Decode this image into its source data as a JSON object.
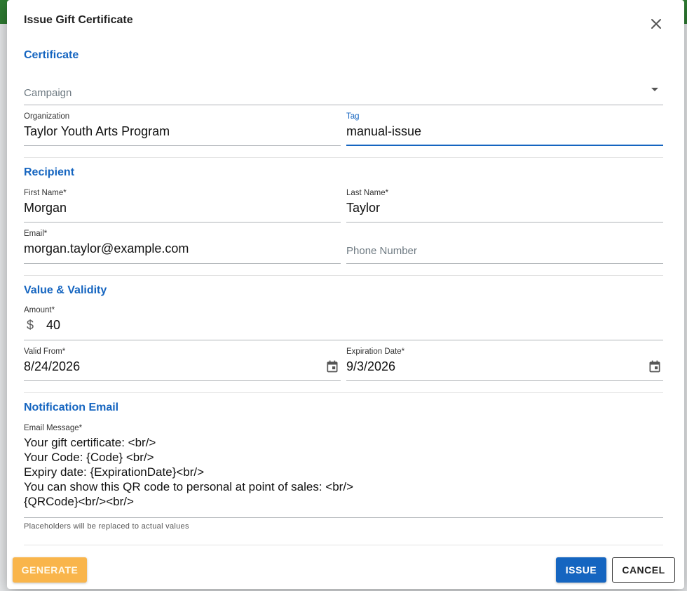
{
  "dialog": {
    "title": "Issue Gift Certificate",
    "close_icon": "close-icon"
  },
  "certificate": {
    "section_title": "Certificate",
    "campaign_placeholder": "Campaign",
    "organization_label": "Organization",
    "organization_value": "Taylor Youth Arts Program",
    "tag_label": "Tag",
    "tag_value": "manual-issue"
  },
  "recipient": {
    "section_title": "Recipient",
    "first_name_label": "First Name*",
    "first_name_value": "Morgan",
    "last_name_label": "Last Name*",
    "last_name_value": "Taylor",
    "email_label": "Email*",
    "email_value": "morgan.taylor@example.com",
    "phone_placeholder": "Phone Number"
  },
  "value_validity": {
    "section_title": "Value & Validity",
    "amount_label": "Amount*",
    "currency_symbol": "$",
    "amount_value": "40",
    "valid_from_label": "Valid From*",
    "valid_from_value": "8/24/2026",
    "expiration_label": "Expiration Date*",
    "expiration_value": "9/3/2026"
  },
  "notification": {
    "section_title": "Notification Email",
    "message_label": "Email Message*",
    "message_lines": [
      "Your gift certificate: <br/>",
      "Your Code: {Code} <br/>",
      "Expiry date: {ExpirationDate}<br/>",
      "You can show this QR code to personal at point of sales: <br/>",
      "{QRCode}<br/><br/>"
    ],
    "hint": "Placeholders will be replaced to actual values"
  },
  "actions": {
    "generate_label": "GENERATE",
    "issue_label": "ISSUE",
    "cancel_label": "CANCEL"
  },
  "colors": {
    "accent": "#1565c0",
    "generate": "#f9b54b",
    "topbar": "#2e7d32"
  }
}
